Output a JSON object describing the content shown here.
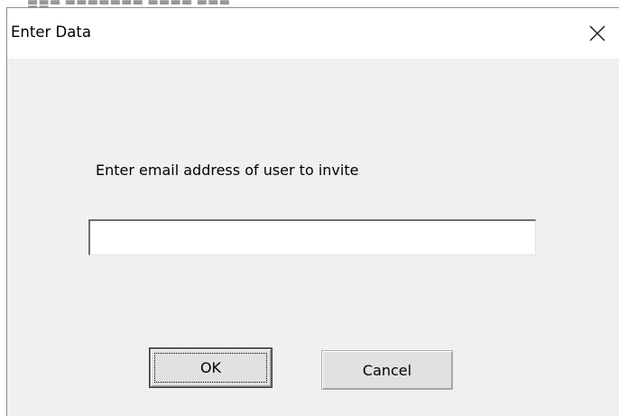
{
  "window": {
    "title": "Enter Data",
    "close_icon": "close-icon"
  },
  "form": {
    "prompt": "Enter email address of user to invite",
    "email_value": ""
  },
  "buttons": {
    "ok_label": "OK",
    "cancel_label": "Cancel"
  },
  "colors": {
    "dialog_background": "#f0f0f0",
    "titlebar_background": "#ffffff",
    "button_face": "#e1e1e1"
  }
}
